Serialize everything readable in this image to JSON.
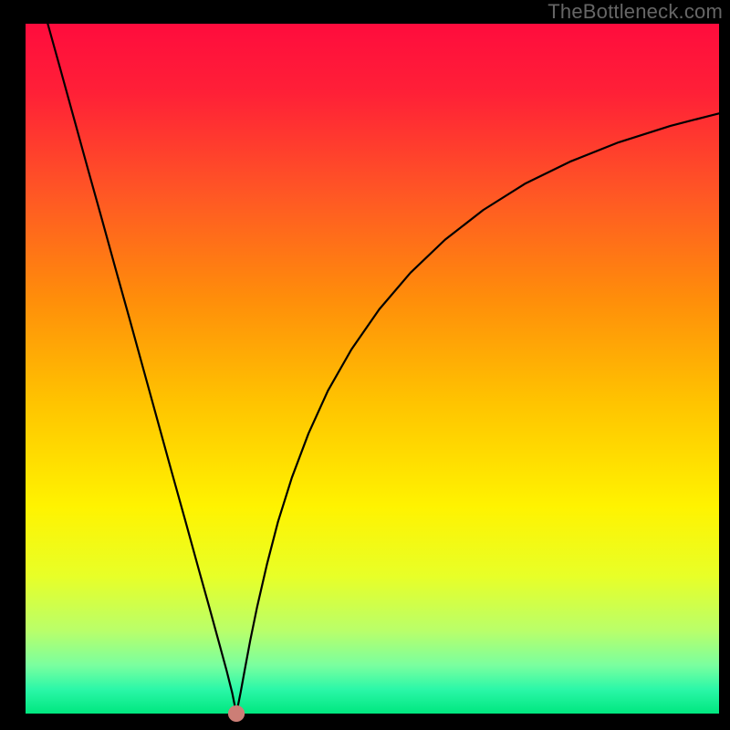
{
  "watermark": "TheBottleneck.com",
  "chart_data": {
    "type": "line",
    "title": "",
    "xlabel": "",
    "ylabel": "",
    "xlim": [
      0,
      100
    ],
    "ylim": [
      0,
      100
    ],
    "background_gradient": {
      "stops": [
        {
          "offset": 0.0,
          "color": "#ff0c3d"
        },
        {
          "offset": 0.1,
          "color": "#ff2037"
        },
        {
          "offset": 0.25,
          "color": "#ff5824"
        },
        {
          "offset": 0.4,
          "color": "#ff8e0a"
        },
        {
          "offset": 0.55,
          "color": "#ffc400"
        },
        {
          "offset": 0.7,
          "color": "#fff300"
        },
        {
          "offset": 0.8,
          "color": "#e8ff27"
        },
        {
          "offset": 0.88,
          "color": "#b9ff6a"
        },
        {
          "offset": 0.93,
          "color": "#7aff9f"
        },
        {
          "offset": 0.965,
          "color": "#2bf7a8"
        },
        {
          "offset": 1.0,
          "color": "#00e77f"
        }
      ]
    },
    "curve_color": "#000000",
    "curve_stroke_width": 2.2,
    "marker": {
      "x": 30.4,
      "y": 0.0,
      "rx": 1.2,
      "ry": 0.8,
      "fill": "#cc7e76"
    },
    "curve": {
      "x": [
        3.2,
        5.0,
        7.0,
        9.0,
        11.0,
        13.0,
        15.0,
        17.0,
        19.0,
        21.0,
        23.0,
        25.0,
        26.5,
        28.0,
        29.0,
        29.8,
        30.4,
        31.0,
        31.6,
        32.4,
        33.4,
        34.8,
        36.4,
        38.4,
        40.8,
        43.6,
        47.0,
        51.0,
        55.5,
        60.5,
        66.0,
        72.0,
        78.5,
        85.5,
        93.0,
        100.0
      ],
      "y": [
        100.0,
        93.5,
        86.2,
        78.9,
        71.7,
        64.4,
        57.2,
        49.9,
        42.6,
        35.3,
        28.1,
        20.8,
        15.4,
        9.9,
        6.2,
        3.0,
        0.0,
        3.0,
        6.3,
        10.6,
        15.5,
        21.6,
        27.8,
        34.2,
        40.6,
        46.8,
        52.8,
        58.6,
        63.9,
        68.7,
        73.0,
        76.8,
        80.0,
        82.8,
        85.2,
        87.0
      ]
    }
  }
}
